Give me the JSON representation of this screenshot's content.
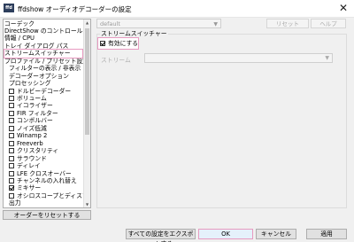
{
  "window": {
    "title": "ffdshow オーディオデコーダーの設定",
    "icon_text": "ffd"
  },
  "toolbar": {
    "preset_value": "default",
    "reset_label": "リセット",
    "help_label": "ヘルプ"
  },
  "tree": {
    "items": [
      {
        "label": "コーデック",
        "indent": 0,
        "checkbox": false
      },
      {
        "label": "DirectShow のコントロール",
        "indent": 0,
        "checkbox": false
      },
      {
        "label": "情報 / CPU",
        "indent": 0,
        "checkbox": false
      },
      {
        "label": "トレイ ダイアログ パス",
        "indent": 0,
        "checkbox": false
      },
      {
        "label": "ストリームスイッチャー",
        "indent": 0,
        "checkbox": false,
        "selected": true
      },
      {
        "label": "プロファイル / プリセット設定",
        "indent": 0,
        "checkbox": false
      },
      {
        "label": "フィルターの表示 / 非表示",
        "indent": 1,
        "checkbox": false
      },
      {
        "label": "デコーダーオプション",
        "indent": 1,
        "checkbox": false
      },
      {
        "label": "プロセッシング",
        "indent": 1,
        "checkbox": false
      },
      {
        "label": "ドルビーデコーダー",
        "indent": 1,
        "checkbox": true,
        "checked": false
      },
      {
        "label": "ボリューム",
        "indent": 1,
        "checkbox": true,
        "checked": false
      },
      {
        "label": "イコライザー",
        "indent": 1,
        "checkbox": true,
        "checked": false
      },
      {
        "label": "FIR フィルター",
        "indent": 1,
        "checkbox": true,
        "checked": false
      },
      {
        "label": "コンボルバー",
        "indent": 1,
        "checkbox": true,
        "checked": false
      },
      {
        "label": "ノイズ低減",
        "indent": 1,
        "checkbox": true,
        "checked": false
      },
      {
        "label": "Winamp 2",
        "indent": 1,
        "checkbox": true,
        "checked": false
      },
      {
        "label": "Freeverb",
        "indent": 1,
        "checkbox": true,
        "checked": false
      },
      {
        "label": "クリスタリティ",
        "indent": 1,
        "checkbox": true,
        "checked": false
      },
      {
        "label": "サラウンド",
        "indent": 1,
        "checkbox": true,
        "checked": false
      },
      {
        "label": "ディレイ",
        "indent": 1,
        "checkbox": true,
        "checked": false
      },
      {
        "label": "LFE クロスオーバー",
        "indent": 1,
        "checkbox": true,
        "checked": false
      },
      {
        "label": "チャンネルの入れ替え",
        "indent": 1,
        "checkbox": true,
        "checked": false
      },
      {
        "label": "ミキサー",
        "indent": 1,
        "checkbox": true,
        "checked": true
      },
      {
        "label": "オシロスコープとディスプレイ",
        "indent": 1,
        "checkbox": true,
        "checked": false
      },
      {
        "label": "出力",
        "indent": 1,
        "checkbox": false
      }
    ],
    "reset_order_label": "オーダーをリセットする"
  },
  "panel": {
    "group_label": "ストリームスイッチャー",
    "enable_label": "有効にする",
    "enable_checked": true,
    "stream_label": "ストリーム",
    "stream_value": ""
  },
  "footer": {
    "export_label": "すべての設定をエクスポートする",
    "ok_label": "OK",
    "cancel_label": "キャンセル",
    "apply_label": "適用"
  }
}
